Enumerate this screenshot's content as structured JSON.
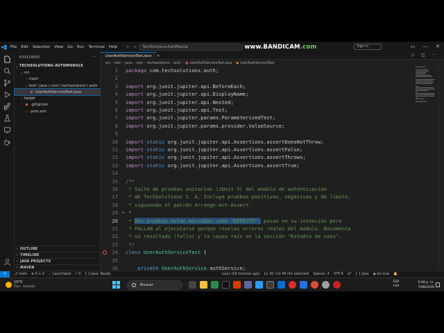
{
  "titlebar": {
    "menus": [
      "File",
      "Edit",
      "Selection",
      "View",
      "Go",
      "Run",
      "Terminal",
      "Help"
    ],
    "command_center": "TechSolutions-AuthModule",
    "recorder_watermark": "www.BANDICAM.com",
    "signin": "Sign in"
  },
  "sidebar": {
    "title": "EXPLORER",
    "root": "TECHSOLUTIONS-AUTHMODULE",
    "items": [
      {
        "label": "src",
        "chev": "⌄",
        "icon": "folder"
      },
      {
        "label": "main",
        "chev": "›",
        "icon": "folder"
      },
      {
        "label": "test \\ java \\ com \\ techsolutions \\ auth",
        "chev": "⌄",
        "icon": "folder"
      },
      {
        "label": "UserAuthServiceTest.java",
        "chev": "",
        "icon": "java-file"
      },
      {
        "label": "target",
        "chev": "›",
        "icon": "folder"
      },
      {
        "label": ".gitignore",
        "chev": "",
        "icon": "git-file"
      },
      {
        "label": "pom.xml",
        "chev": "",
        "icon": "xml-file"
      }
    ],
    "sections": [
      "OUTLINE",
      "TIMELINE",
      "JAVA PROJECTS",
      "MAVEN"
    ]
  },
  "editor": {
    "tab": "UserAuthServiceTest.java",
    "breadcrumb": [
      "src",
      "test",
      "java",
      "com",
      "techsolutions",
      "auth",
      "UserAuthServiceTest.java",
      "UserAuthServiceTest"
    ],
    "lines": [
      {
        "n": "1",
        "text": "package com.techsolutions.auth;"
      },
      {
        "n": "2",
        "text": ""
      },
      {
        "n": "3",
        "text": "import org.junit.jupiter.api.BeforeEach;"
      },
      {
        "n": "4",
        "text": "import org.junit.jupiter.api.DisplayName;"
      },
      {
        "n": "5",
        "text": "import org.junit.jupiter.api.Nested;"
      },
      {
        "n": "6",
        "text": "import org.junit.jupiter.api.Test;"
      },
      {
        "n": "7",
        "text": "import org.junit.jupiter.params.ParameterizedTest;"
      },
      {
        "n": "8",
        "text": "import org.junit.jupiter.params.provider.ValueSource;"
      },
      {
        "n": "9",
        "text": ""
      },
      {
        "n": "10",
        "text": "import static org.junit.jupiter.api.Assertions.assertDoesNotThrow;"
      },
      {
        "n": "11",
        "text": "import static org.junit.jupiter.api.Assertions.assertFalse;"
      },
      {
        "n": "12",
        "text": "import static org.junit.jupiter.api.Assertions.assertThrows;"
      },
      {
        "n": "13",
        "text": "import static org.junit.jupiter.api.Assertions.assertTrue;"
      },
      {
        "n": "14",
        "text": ""
      },
      {
        "n": "15",
        "text": "/**"
      },
      {
        "n": "16",
        "text": " * Suite de pruebas unitarias (JUnit 5) del módulo de autenticación"
      },
      {
        "n": "17",
        "text": " * de TechSolutions S. A. Incluye pruebas positivas, negativas y de límite,"
      },
      {
        "n": "18",
        "text": " * siguiendo el patrón Arrange-Act-Assert."
      },
      {
        "n": "19",
        "text": " *"
      },
      {
        "n": "20",
        "text": " * Dos pruebas están marcadas como \"DEFECTO\": pasan en su intención pero"
      },
      {
        "n": "21",
        "text": " * FALLAN al ejecutarse porque revelan errores reales del módulo. Documenta"
      },
      {
        "n": "22",
        "text": " * su resultado (fallo) y la causa raíz en la sección \"Estudio de caso\"."
      },
      {
        "n": "23",
        "text": " */"
      },
      {
        "n": "24",
        "text": "class UserAuthServiceTest {"
      },
      {
        "n": "25",
        "text": ""
      },
      {
        "n": "26",
        "text": "    private UserAuthService authService;"
      }
    ],
    "line20_prefix": " * ",
    "line20_selected": "Dos pruebas están marcadas como \"DEFECTO\":",
    "line20_suffix": " pasan en su intención pero"
  },
  "statusbar": {
    "branch": "main",
    "problems": "⊗ 0 ⚠ 0",
    "launchpad": "Launchpad",
    "ports": "⚡ 0",
    "java": "Java: Ready",
    "blame": "Louis (19 minutes ago)",
    "position": "Ln 20, Col 46 (42 selected)",
    "spaces": "Spaces: 4",
    "encoding": "UTF-8",
    "eol": "LF",
    "language": "{ } Java",
    "golive": "Go Live"
  },
  "taskbar": {
    "temp": "15°C",
    "weather": "Parc. soleado",
    "search": "Buscar",
    "lang": "ESP LAA",
    "time": "6:08 p. m.",
    "date": "7/08/2026"
  }
}
